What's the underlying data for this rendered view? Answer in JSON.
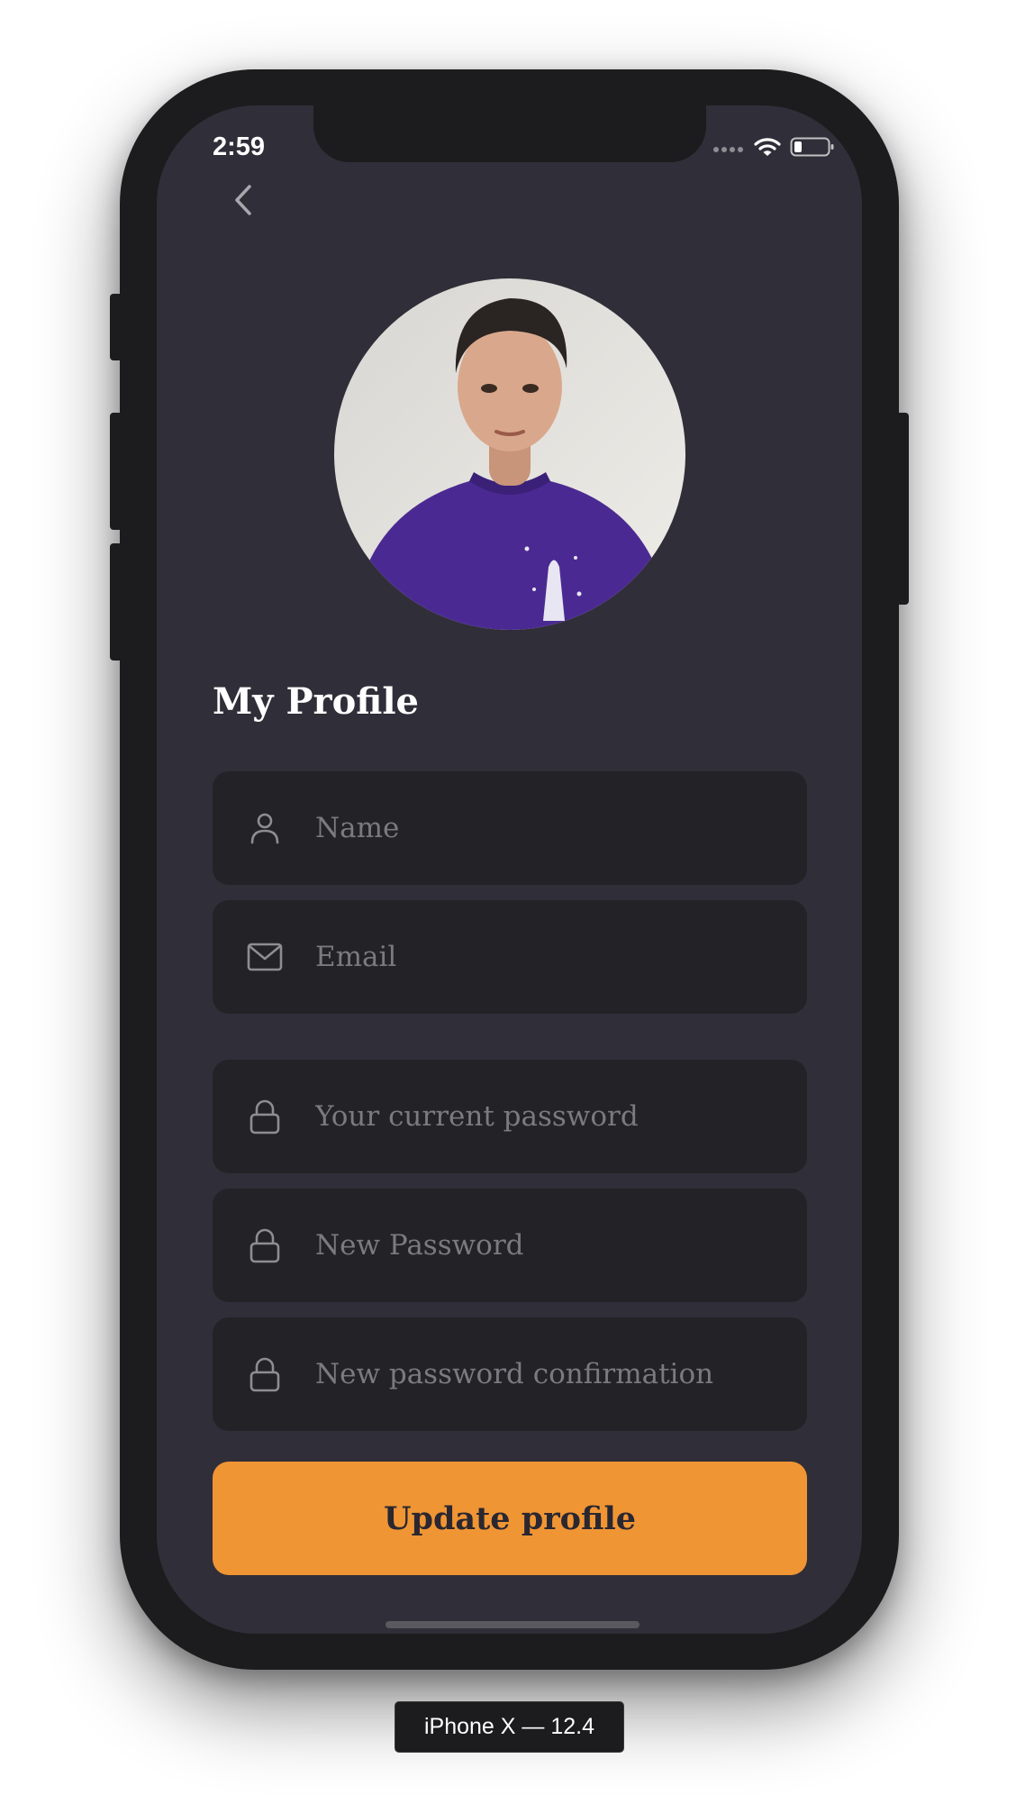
{
  "status_bar": {
    "time": "2:59"
  },
  "profile": {
    "title": "My Profile",
    "fields": [
      {
        "icon": "user-icon",
        "placeholder": "Name",
        "value": ""
      },
      {
        "icon": "mail-icon",
        "placeholder": "Email",
        "value": ""
      },
      {
        "icon": "lock-icon",
        "placeholder": "Your current password",
        "value": ""
      },
      {
        "icon": "lock-icon",
        "placeholder": "New Password",
        "value": ""
      },
      {
        "icon": "lock-icon",
        "placeholder": "New password confirmation",
        "value": ""
      }
    ],
    "submit_label": "Update profile"
  },
  "device_label": "iPhone X — 12.4",
  "colors": {
    "background": "#302e38",
    "field_background": "#232227",
    "accent": "#f09534",
    "placeholder": "#7b7a80"
  }
}
